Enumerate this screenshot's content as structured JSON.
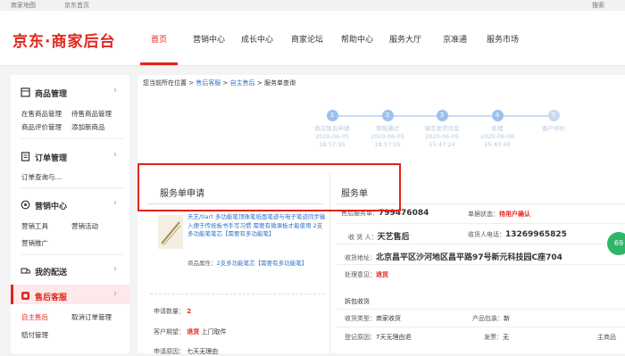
{
  "topbar": {
    "home_link": "商家地图",
    "jd_home": "京东首页",
    "search": "搜索"
  },
  "header": {
    "logo": "京东·商家后台",
    "nav": [
      "首页",
      "营销中心",
      "成长中心",
      "商家论坛",
      "帮助中心",
      "服务大厅",
      "京准通",
      "服务市场"
    ],
    "active_nav": "首页"
  },
  "sidebar": {
    "sections": [
      {
        "title": "商品管理",
        "items": [
          "在售商品管理",
          "待售商品管理",
          "商品评价管理",
          "添加新商品"
        ]
      },
      {
        "title": "订单管理",
        "items": [
          "订单查询与..."
        ]
      },
      {
        "title": "营销中心",
        "items": [
          "营销工具",
          "营销活动",
          "营销推广"
        ]
      },
      {
        "title": "我的配送",
        "items": []
      },
      {
        "title": "售后客服",
        "items": [
          "自主售后",
          "取消订单管理",
          "赔付管理"
        ]
      }
    ]
  },
  "breadcrumb": {
    "prefix": "您当前所在位置",
    "sep": " > ",
    "l1": "售后客服",
    "l2": "自主售后",
    "current": "服务单查询"
  },
  "steps": [
    {
      "num": "1",
      "label": "商交售后申请",
      "date": "2020-06-05",
      "time": "18:57:55"
    },
    {
      "num": "2",
      "label": "审核通过",
      "date": "2020-06-05",
      "time": "18:57:55"
    },
    {
      "num": "3",
      "label": "填写发货信息",
      "date": "2020-06-05",
      "time": "15:47:24"
    },
    {
      "num": "4",
      "label": "处理",
      "date": "2020-06-08",
      "time": "15:43:40"
    },
    {
      "num": "5",
      "label": "客户评价",
      "date": "",
      "time": ""
    }
  ],
  "left_panel": {
    "title": "服务单申请",
    "product_link": "天艺/tiart 多功能笔顶珠笔纸面笔迹与电子笔迹同步输入便于传统板书手写习惯 需要有微课板才能使用 2支多功能笔笔芯【需要有多功能笔】",
    "attr_label": "商品属性：",
    "attr_value": "2支多功能笔芯【需要有多功能笔】",
    "rows": [
      {
        "label": "申请数量：",
        "value": "2"
      },
      {
        "label": "客户期望：",
        "value": "退货",
        "extra": "上门取件"
      },
      {
        "label": "申请原因：",
        "value": "七天无理由"
      }
    ]
  },
  "right_panel": {
    "title": "服务单",
    "service_no_label": "售后服务单：",
    "service_no": "799476084",
    "status_label": "单据状态：",
    "status": "待用户确认",
    "receiver_label": "收 货 人：",
    "receiver": "天艺售后",
    "phone_label": "收货人电话：",
    "phone": "13269965825",
    "addr_label": "收货地址：",
    "addr": "北京昌平区沙河地区昌平路97号新元科技园C座704",
    "opinion_label": "处理意见：",
    "opinion": "退货",
    "pack_label": "拆包收货",
    "recv_type_label": "收货类型：",
    "recv_type": "商家收货",
    "pkg_label": "产品包装：",
    "pkg": "新",
    "reg_label": "登记原因：",
    "reg": "7天无理由退",
    "invoice_label": "发票：",
    "invoice": "无",
    "main_label": "主商品"
  },
  "badge": "69"
}
